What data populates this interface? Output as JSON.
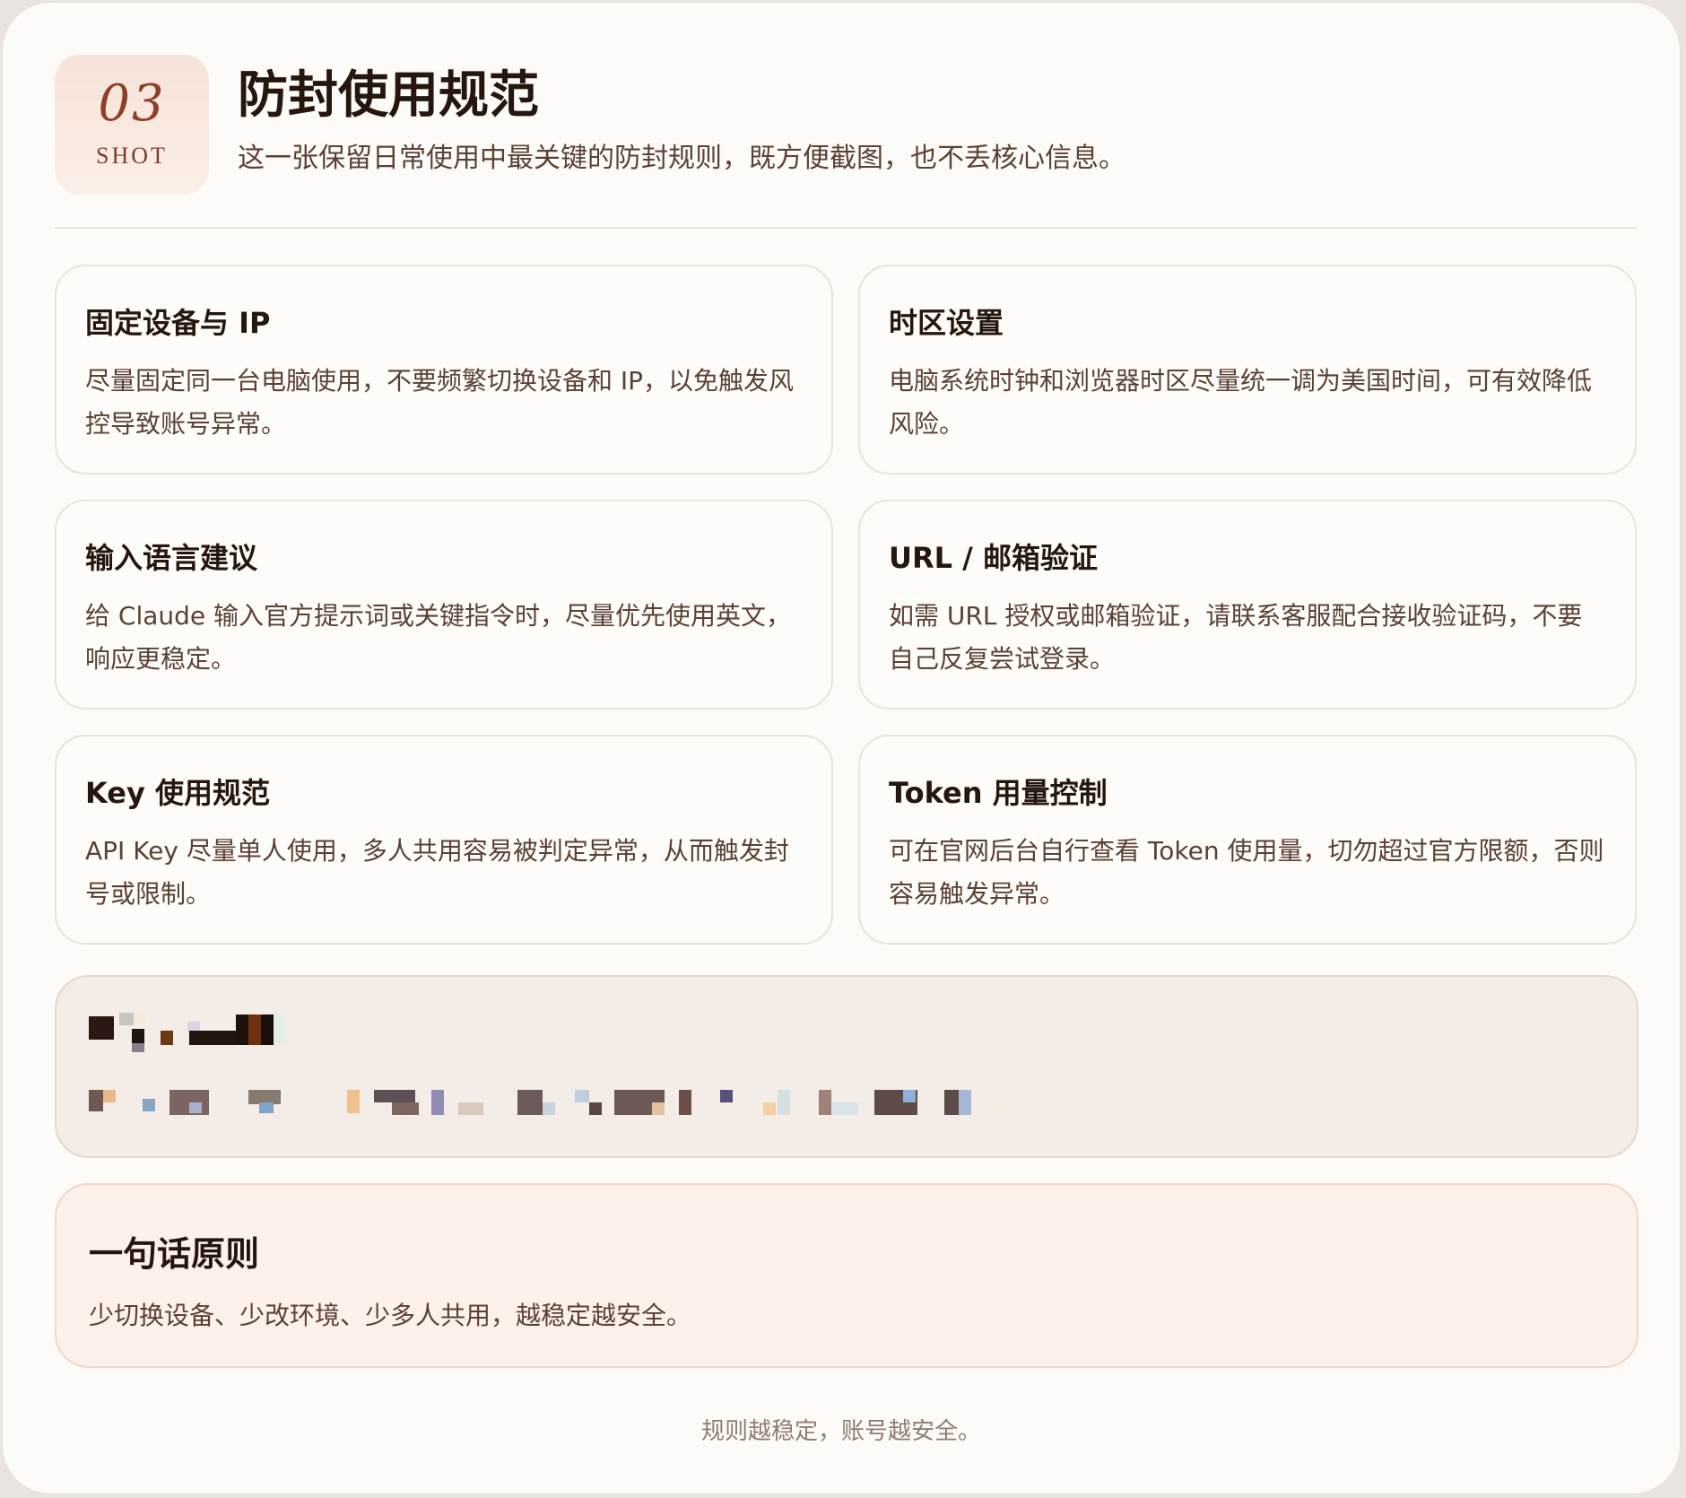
{
  "header": {
    "badge_number": "03",
    "badge_label": "SHOT",
    "title": "防封使用规范",
    "subtitle": "这一张保留日常使用中最关键的防封规则，既方便截图，也不丢核心信息。"
  },
  "cards": [
    {
      "title": "固定设备与 IP",
      "body": "尽量固定同一台电脑使用，不要频繁切换设备和 IP，以免触发风控导致账号异常。"
    },
    {
      "title": "时区设置",
      "body": "电脑系统时钟和浏览器时区尽量统一调为美国时间，可有效降低风险。"
    },
    {
      "title": "输入语言建议",
      "body": "给 Claude 输入官方提示词或关键指令时，尽量优先使用英文，响应更稳定。"
    },
    {
      "title": "URL / 邮箱验证",
      "body": "如需 URL 授权或邮箱验证，请联系客服配合接收验证码，不要自己反复尝试登录。"
    },
    {
      "title": "Key 使用规范",
      "body": "API Key 尽量单人使用，多人共用容易被判定异常，从而触发封号或限制。"
    },
    {
      "title": "Token 用量控制",
      "body": "可在官网后台自行查看 Token 使用量，切勿超过官方限额，否则容易触发异常。"
    }
  ],
  "principle": {
    "title": "一句话原则",
    "body": "少切换设备、少改环境、少多人共用，越稳定越安全。"
  },
  "footer": {
    "text": "规则越稳定，账号越安全。"
  }
}
